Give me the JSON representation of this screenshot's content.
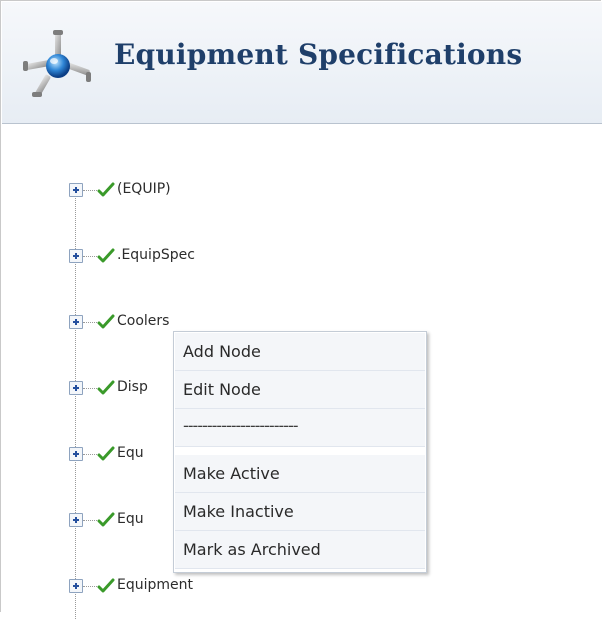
{
  "header": {
    "title": "Equipment Specifications",
    "icon": "network-node-icon"
  },
  "tree": {
    "nodes": [
      {
        "label": "(EQUIP)",
        "status": "active"
      },
      {
        "label": ".EquipSpec",
        "status": "active"
      },
      {
        "label": "Coolers",
        "status": "active"
      },
      {
        "label": "Disp",
        "status": "active"
      },
      {
        "label": "Equ",
        "status": "active"
      },
      {
        "label": "Equ",
        "status": "active"
      },
      {
        "label": "Equipment",
        "status": "active"
      }
    ]
  },
  "context_menu": {
    "items": [
      {
        "label": "Add Node"
      },
      {
        "label": "Edit Node"
      },
      {
        "label": "------------------------"
      },
      {
        "label": "Make Active"
      },
      {
        "label": "Make Inactive"
      },
      {
        "label": "Mark as Archived"
      }
    ]
  },
  "colors": {
    "title": "#1f3f6a",
    "check": "#3a9a2a",
    "header_bg": "#e7edf4"
  }
}
